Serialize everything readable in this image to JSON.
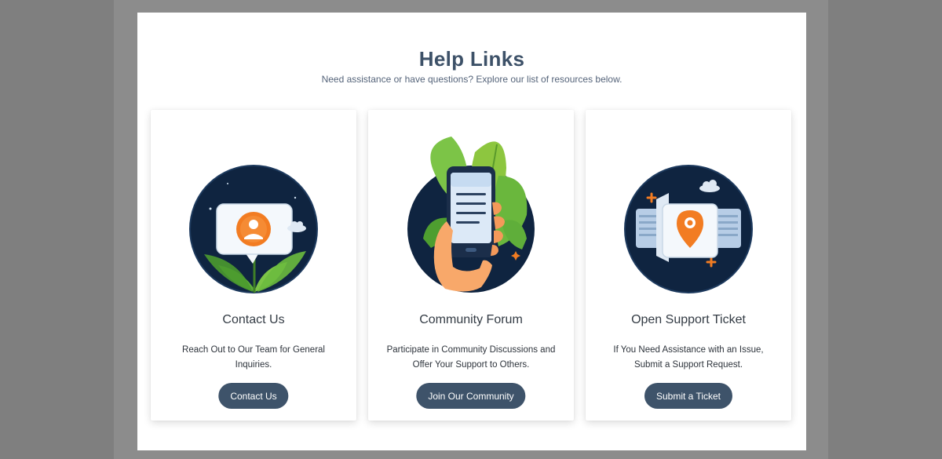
{
  "header": {
    "title": "Help Links",
    "subtitle": "Need assistance or have questions? Explore our list of resources below."
  },
  "cards": [
    {
      "title": "Contact Us",
      "description": "Reach Out to Our Team for General Inquiries.",
      "button_label": "Contact Us",
      "icon": "chat-bubble-contact-icon"
    },
    {
      "title": "Community Forum",
      "description": "Participate in Community Discussions and Offer Your Support to Others.",
      "button_label": "Join Our Community",
      "icon": "smartphone-hand-icon"
    },
    {
      "title": "Open Support Ticket",
      "description": "If You Need Assistance with an Issue, Submit a Support Request.",
      "button_label": "Submit a Ticket",
      "icon": "location-ticket-icon"
    }
  ],
  "colors": {
    "button_bg": "#3e536a",
    "title_text": "#3d5168",
    "illustration_navy": "#0f2440",
    "accent_orange": "#f27c22",
    "leaf_green": "#5fae3a"
  }
}
